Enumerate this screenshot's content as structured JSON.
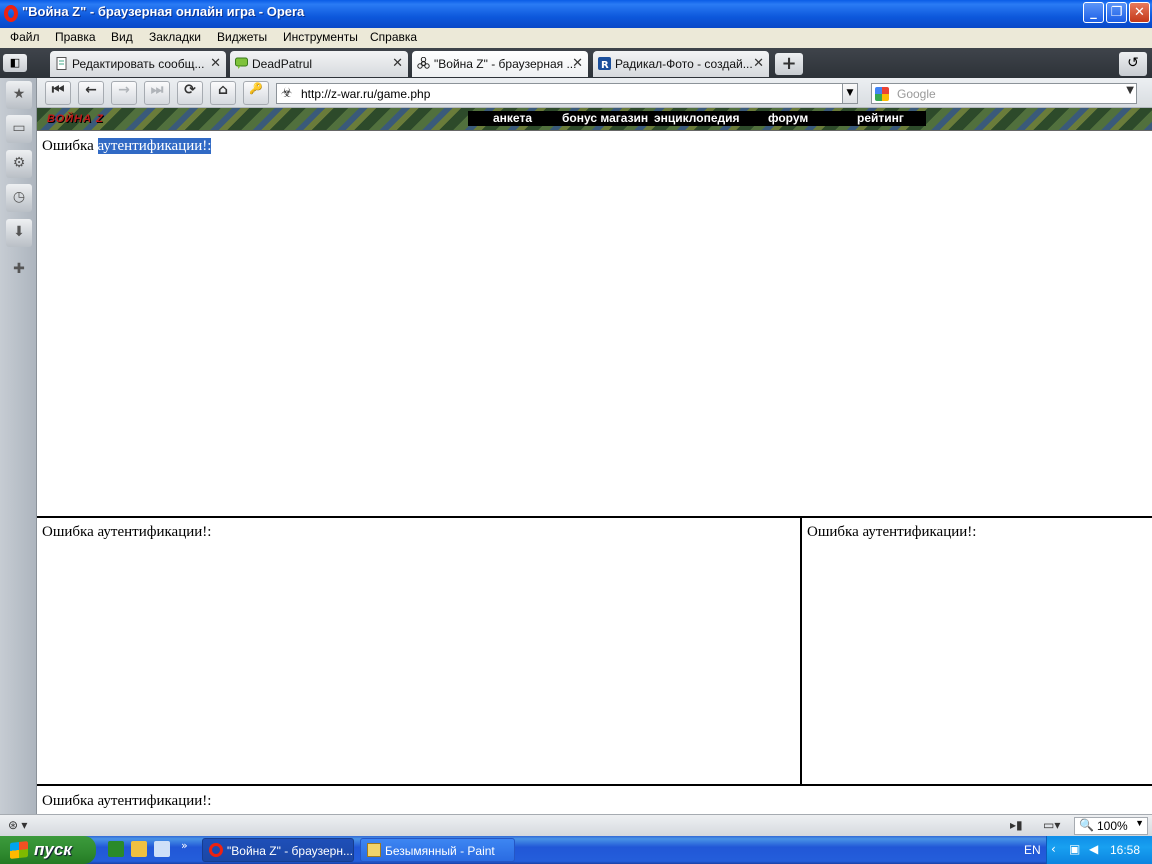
{
  "window": {
    "title": "\"Война Z\" - браузерная онлайн игра - Opera",
    "minimize": "_",
    "maximize": "❐",
    "close": "✕"
  },
  "menu": [
    "Файл",
    "Правка",
    "Вид",
    "Закладки",
    "Виджеты",
    "Инструменты",
    "Справка"
  ],
  "tabs": [
    {
      "label": "Редактировать сообщ...",
      "close": "✕"
    },
    {
      "label": "DeadPatrul",
      "close": "✕"
    },
    {
      "label": "\"Война Z\" - браузерная ...",
      "close": "✕"
    },
    {
      "label": "Радикал-Фото - создай...",
      "close": "✕"
    }
  ],
  "toolbar": {
    "back_fast": "⏮",
    "back": "←",
    "forward": "→",
    "forward_fast": "⏭",
    "reload": "⟳",
    "home": "⌂",
    "wand": "🔑",
    "address": "http://z-war.ru/game.php",
    "search_placeholder": "Google"
  },
  "game": {
    "logo": "ВОЙНА Z",
    "nav": [
      "анкета",
      "бонус магазин",
      "энциклопедия",
      "форум",
      "рейтинг"
    ]
  },
  "frames": {
    "top_error_prefix": "Ошибка ",
    "top_error_selected": "аутентификации!:",
    "bottom_left_error": "Ошибка аутентификации!:",
    "bottom_right_error": "Ошибка аутентификации!:",
    "footer_error": "Ошибка аутентификации!:"
  },
  "status": {
    "zoom": "100%"
  },
  "taskbar": {
    "start": "пуск",
    "tasks": [
      {
        "label": "\"Война Z\" - браузерн..."
      },
      {
        "label": "Безымянный - Paint"
      }
    ],
    "lang": "EN",
    "time": "16:58"
  },
  "colors": {
    "selection": "#316ac5",
    "title_bar": "#0a5ce6",
    "taskbar": "#245edb",
    "start_green": "#3c9a3c"
  }
}
